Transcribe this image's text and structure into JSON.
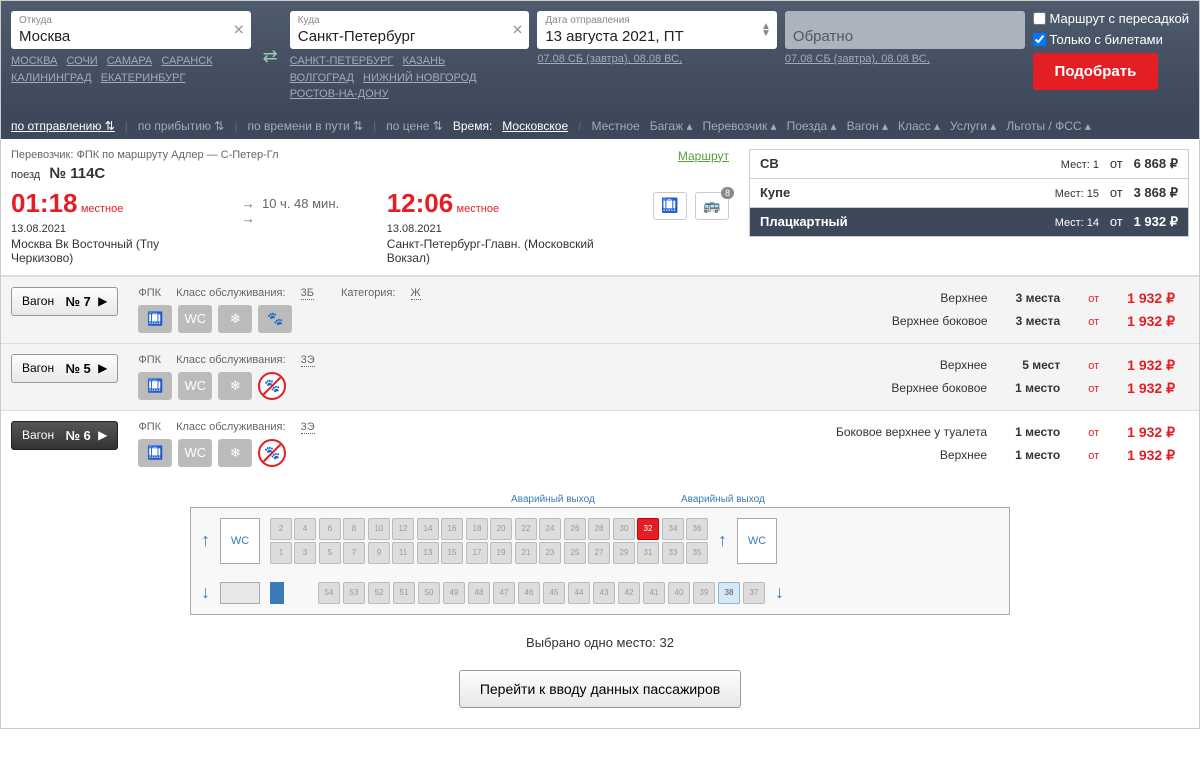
{
  "search": {
    "from_label": "Откуда",
    "from_value": "Москва",
    "to_label": "Куда",
    "to_value": "Санкт-Петербург",
    "date_label": "Дата отправления",
    "date_value": "13 августа 2021, ПТ",
    "return_label": "Обратно",
    "from_hints": [
      "МОСКВА",
      "СОЧИ",
      "САМАРА",
      "САРАНСК",
      "КАЛИНИНГРАД",
      "ЕКАТЕРИНБУРГ"
    ],
    "to_hints": [
      "САНКТ-ПЕТЕРБУРГ",
      "КАЗАНЬ",
      "ВОЛГОГРАД",
      "НИЖНИЙ НОВГОРОД",
      "РОСТОВ-НА-ДОНУ"
    ],
    "date_hints": "07.08 СБ (завтра), 08.08 ВС,",
    "return_hints": "07.08 СБ (завтра), 08.08 ВС,",
    "cb_transfer": "Маршрут с пересадкой",
    "cb_tickets": "Только с билетами",
    "submit": "Подобрать"
  },
  "filters": {
    "sort_dep": "по отправлению",
    "sort_arr": "по прибытию",
    "sort_dur": "по времени в пути",
    "sort_price": "по цене",
    "time": "Время:",
    "moscow": "Московское",
    "local": "Местное",
    "baggage": "Багаж",
    "carrier": "Перевозчик",
    "trains": "Поезда",
    "wagon": "Вагон",
    "class": "Класс",
    "services": "Услуги",
    "benefits": "Льготы / ФСС"
  },
  "train": {
    "carrier_meta": "Перевозчик: ФПК   по маршруту Адлер — С-Петер-Гл",
    "label": "поезд",
    "number": "№ 114С",
    "route_link": "Маршрут",
    "dep_time": "01:18",
    "dep_tz": "местное",
    "dep_date": "13.08.2021",
    "dep_station": "Москва Вк Восточный (Тпу Черкизово)",
    "duration": "10 ч. 48 мин.",
    "arr_time": "12:06",
    "arr_tz": "местное",
    "arr_date": "13.08.2021",
    "arr_station": "Санкт-Петербург-Главн. (Московский Вокзал)",
    "badge_count": "8"
  },
  "classes": [
    {
      "name": "СВ",
      "seats": "Мест: 1",
      "from": "от",
      "price": "6 868 ₽"
    },
    {
      "name": "Купе",
      "seats": "Мест: 15",
      "from": "от",
      "price": "3 868 ₽"
    },
    {
      "name": "Плацкартный",
      "seats": "Мест: 14",
      "from": "от",
      "price": "1 932 ₽"
    }
  ],
  "wagons": [
    {
      "btn_label": "Вагон",
      "btn_num": "№ 7",
      "carrier": "ФПК",
      "class_label": "Класс обслуживания:",
      "class": "3Б",
      "cat_label": "Категория:",
      "cat": "Ж",
      "rows": [
        {
          "type": "Верхнее",
          "count": "3 места",
          "from": "от",
          "price": "1 932 ₽"
        },
        {
          "type": "Верхнее боковое",
          "count": "3 места",
          "from": "от",
          "price": "1 932 ₽"
        }
      ]
    },
    {
      "btn_label": "Вагон",
      "btn_num": "№ 5",
      "carrier": "ФПК",
      "class_label": "Класс обслуживания:",
      "class": "3Э",
      "rows": [
        {
          "type": "Верхнее",
          "count": "5 мест",
          "from": "от",
          "price": "1 932 ₽"
        },
        {
          "type": "Верхнее боковое",
          "count": "1 место",
          "from": "от",
          "price": "1 932 ₽"
        }
      ]
    },
    {
      "btn_label": "Вагон",
      "btn_num": "№ 6",
      "carrier": "ФПК",
      "class_label": "Класс обслуживания:",
      "class": "3Э",
      "rows": [
        {
          "type": "Боковое верхнее у туалета",
          "count": "1 место",
          "from": "от",
          "price": "1 932 ₽"
        },
        {
          "type": "Верхнее",
          "count": "1 место",
          "from": "от",
          "price": "1 932 ₽"
        }
      ]
    }
  ],
  "scheme": {
    "exit_label1": "Аварийный выход",
    "exit_label2": "Аварийный выход",
    "wc": "WC",
    "selected_seat": "32",
    "avail_seat": "38"
  },
  "footer": {
    "selected_text": "Выбрано одно место: 32",
    "proceed": "Перейти к вводу данных пассажиров"
  }
}
